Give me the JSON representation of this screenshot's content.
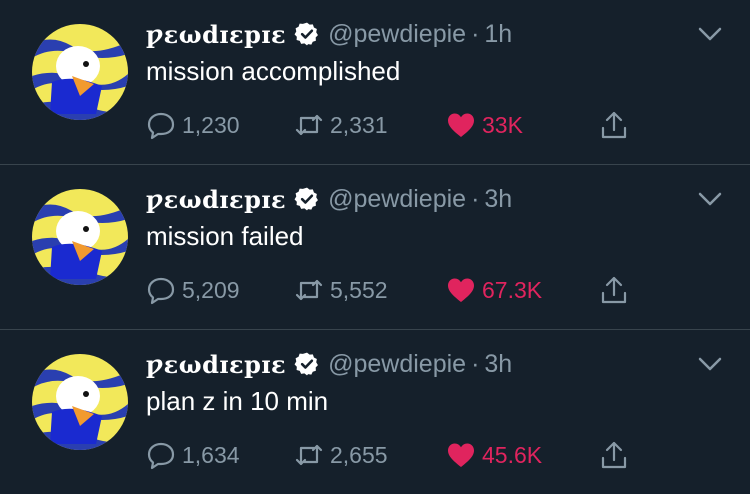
{
  "colors": {
    "background": "#15202b",
    "divider": "#38444d",
    "muted_text": "#8899a6",
    "like": "#e0245e",
    "verified_badge": "#ffffff"
  },
  "icons": {
    "reply": "speech-bubble",
    "retweet": "retweet-arrows",
    "like": "heart",
    "share": "upload-arrow",
    "menu": "chevron-down",
    "verified": "verified-badge"
  },
  "tweets": [
    {
      "display_name": "ƿɛωdɪɛpɪɛ",
      "handle": "@pewdiepie",
      "separator": "·",
      "time": "1h",
      "text": "mission accomplished",
      "replies": "1,230",
      "retweets": "2,331",
      "likes": "33K"
    },
    {
      "display_name": "ƿɛωdɪɛpɪɛ",
      "handle": "@pewdiepie",
      "separator": "·",
      "time": "3h",
      "text": "mission failed",
      "replies": "5,209",
      "retweets": "5,552",
      "likes": "67.3K"
    },
    {
      "display_name": "ƿɛωdɪɛpɪɛ",
      "handle": "@pewdiepie",
      "separator": "·",
      "time": "3h",
      "text": "plan z in 10 min",
      "replies": "1,634",
      "retweets": "2,655",
      "likes": "45.6K"
    }
  ]
}
